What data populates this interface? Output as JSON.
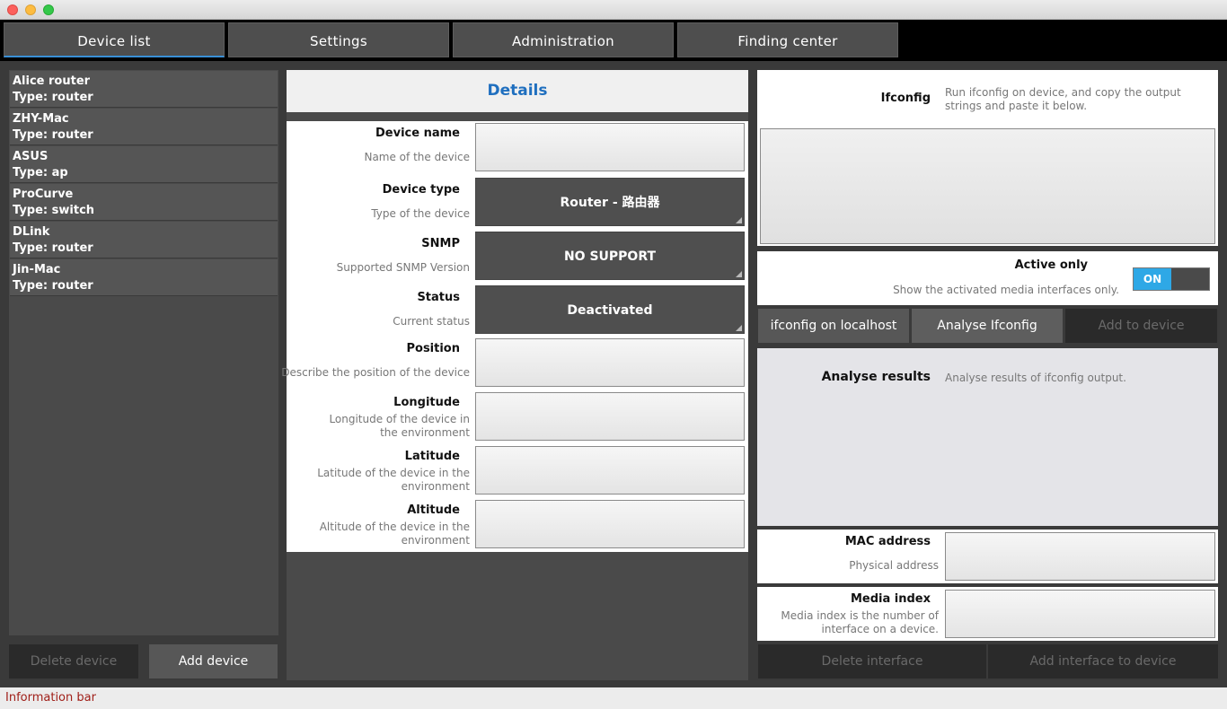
{
  "tabs": [
    {
      "label": "Device list"
    },
    {
      "label": "Settings"
    },
    {
      "label": "Administration"
    },
    {
      "label": "Finding center"
    }
  ],
  "devices": [
    {
      "name": "Alice router",
      "type": "Type: router"
    },
    {
      "name": "ZHY-Mac",
      "type": "Type: router"
    },
    {
      "name": "ASUS",
      "type": "Type: ap"
    },
    {
      "name": "ProCurve",
      "type": "Type: switch"
    },
    {
      "name": "DLink",
      "type": "Type: router"
    },
    {
      "name": "Jin-Mac",
      "type": "Type: router"
    }
  ],
  "left_buttons": {
    "delete": "Delete device",
    "add": "Add device"
  },
  "details": {
    "title": "Details",
    "fields": {
      "device_name": {
        "label": "Device name",
        "desc": "Name of the device",
        "value": ""
      },
      "device_type": {
        "label": "Device type",
        "desc": "Type of the device",
        "value": "Router - 路由器"
      },
      "snmp": {
        "label": "SNMP",
        "desc": "Supported SNMP Version",
        "value": "NO SUPPORT"
      },
      "status": {
        "label": "Status",
        "desc": "Current status",
        "value": "Deactivated"
      },
      "position": {
        "label": "Position",
        "desc": "Describe the position of the device",
        "value": ""
      },
      "longitude": {
        "label": "Longitude",
        "desc": "Longitude of the device in the environment",
        "value": ""
      },
      "latitude": {
        "label": "Latitude",
        "desc": "Latitude of the device in the environment",
        "value": ""
      },
      "altitude": {
        "label": "Altitude",
        "desc": "Altitude of the device in the environment",
        "value": ""
      }
    }
  },
  "ifconfig": {
    "label": "Ifconfig",
    "desc": "Run ifconfig on device, and copy the output strings and paste it below.",
    "value": ""
  },
  "active_only": {
    "label": "Active only",
    "desc": "Show the activated media interfaces only.",
    "toggle": "ON"
  },
  "ifconfig_buttons": {
    "localhost": "ifconfig on localhost",
    "analyse": "Analyse Ifconfig",
    "add": "Add to device"
  },
  "results": {
    "label": "Analyse results",
    "desc": "Analyse results of ifconfig output."
  },
  "mac": {
    "label": "MAC address",
    "desc": "Physical address",
    "value": ""
  },
  "media": {
    "label": "Media index",
    "desc": "Media index is the number of interface on a device.",
    "value": ""
  },
  "interface_buttons": {
    "delete": "Delete interface",
    "add": "Add interface to device"
  },
  "infobar": "Information bar",
  "colors": {
    "accent": "#3a8fd6",
    "toggle_on": "#2ea8e6",
    "title_blue": "#1f6fbf",
    "info_red": "#a0201a"
  }
}
